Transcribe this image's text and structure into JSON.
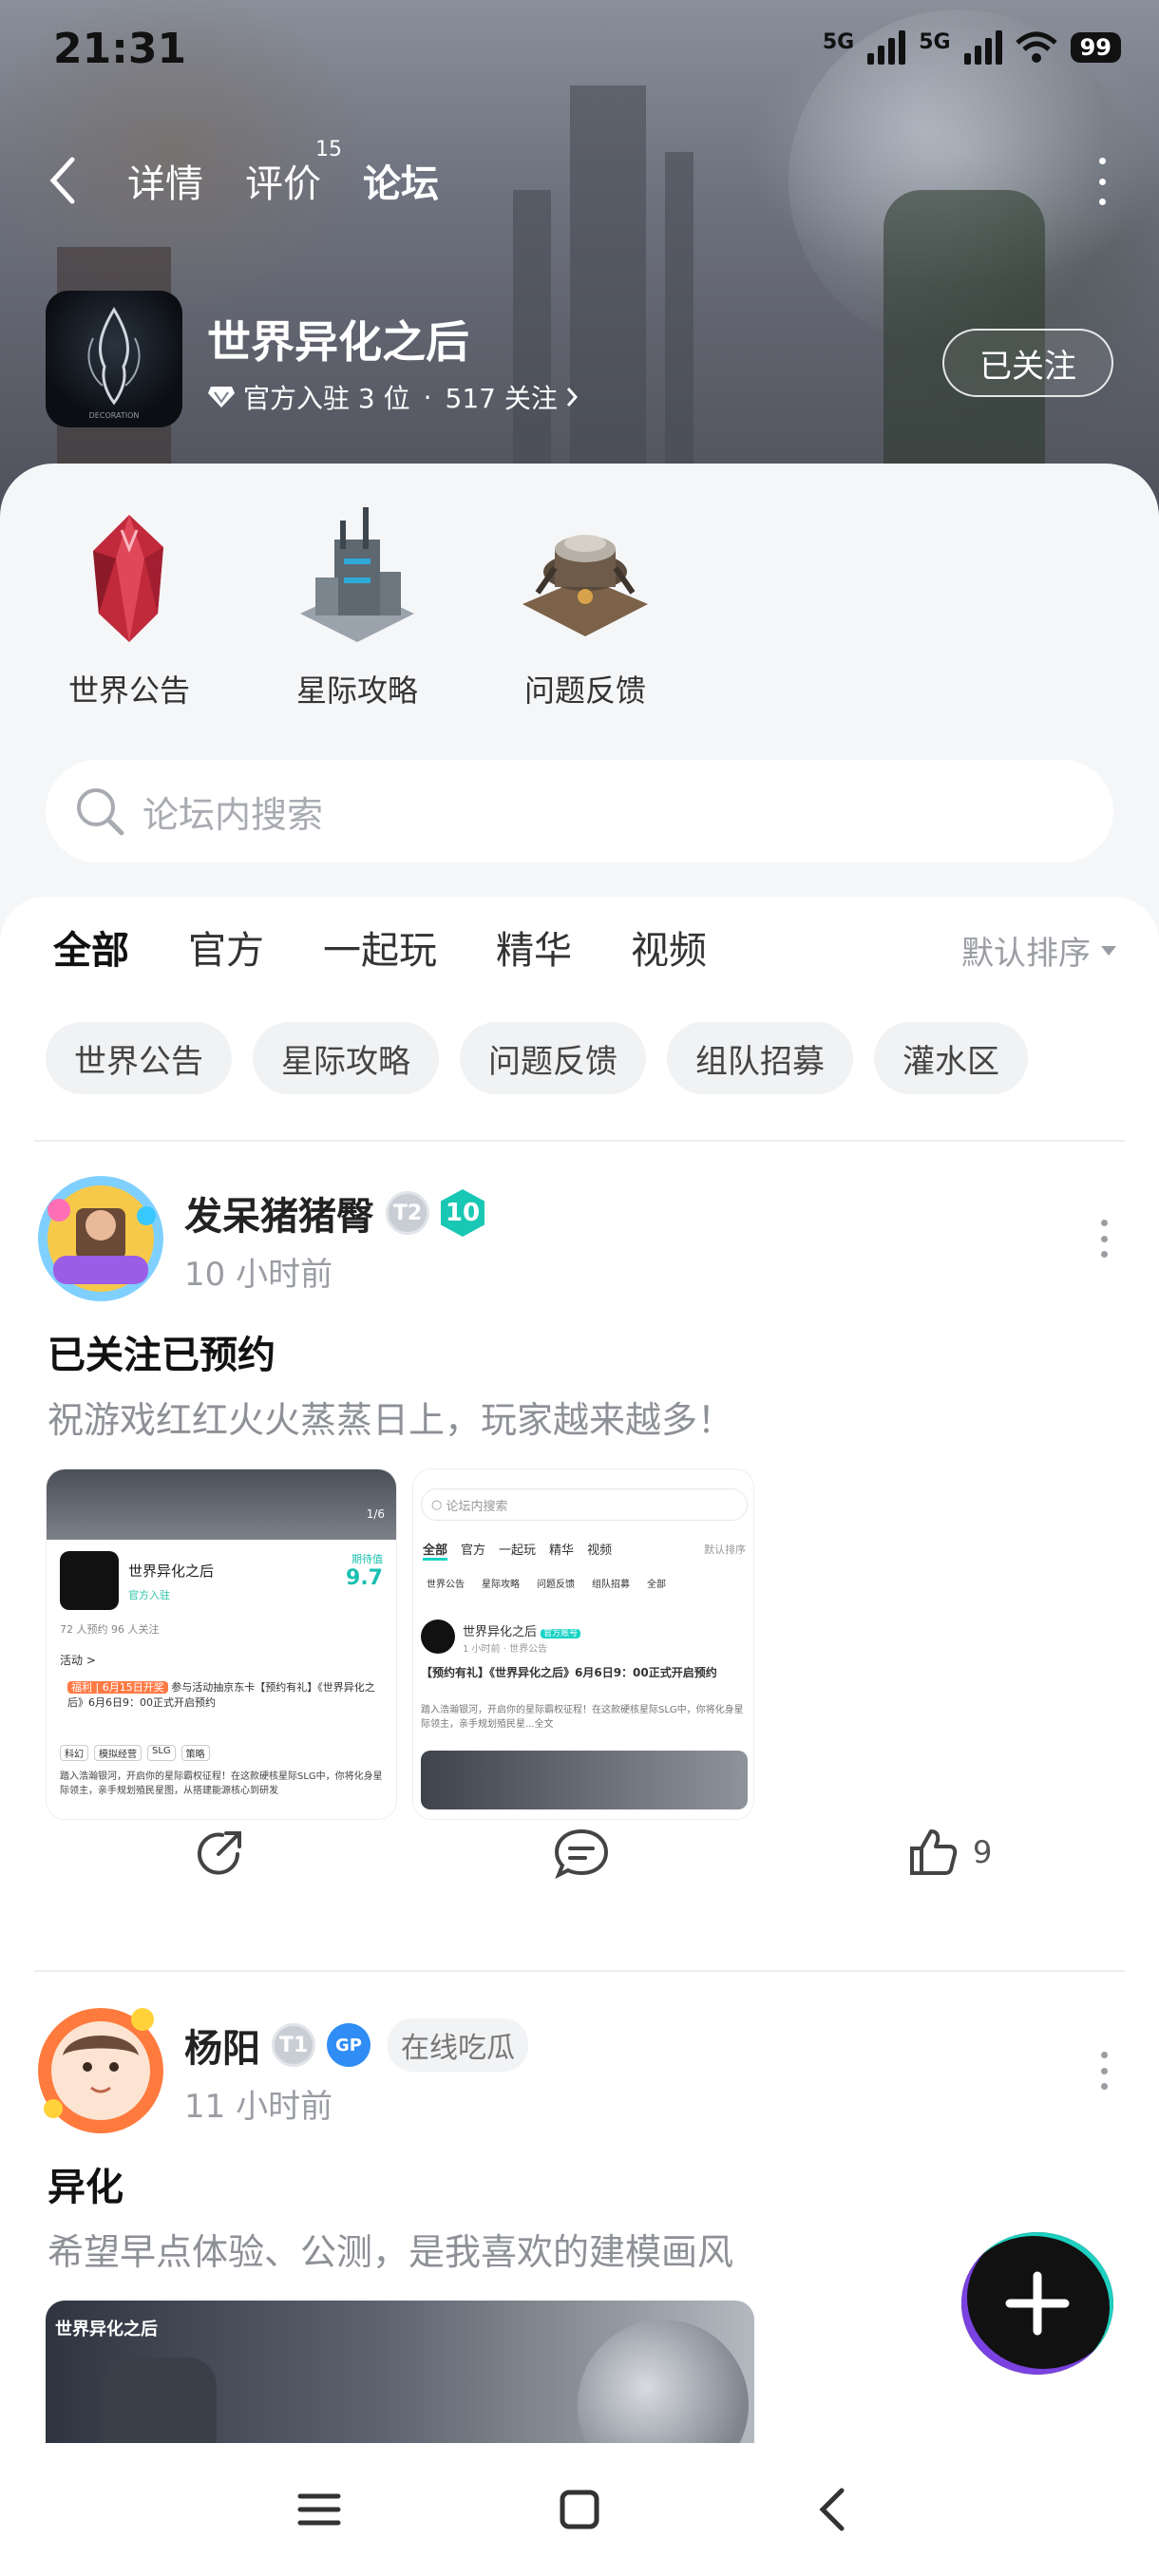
{
  "status_bar": {
    "time": "21:31",
    "net1": "5G",
    "net2": "5G",
    "battery": "99"
  },
  "top_nav": {
    "tabs": [
      {
        "label": "详情"
      },
      {
        "label": "评价",
        "count": "15"
      },
      {
        "label": "论坛"
      }
    ],
    "active_tab": "论坛"
  },
  "game": {
    "title": "世界异化之后",
    "icon_text": "DECORATION",
    "officials": "官方入驻 3 位",
    "separator": "·",
    "followers": "517 关注",
    "follow_button": "已关注"
  },
  "categories": [
    {
      "label": "世界公告"
    },
    {
      "label": "星际攻略"
    },
    {
      "label": "问题反馈"
    }
  ],
  "search": {
    "placeholder": "论坛内搜索"
  },
  "filter_tabs": [
    "全部",
    "官方",
    "一起玩",
    "精华",
    "视频"
  ],
  "sort_label": "默认排序",
  "chips": [
    "世界公告",
    "星际攻略",
    "问题反馈",
    "组队招募",
    "灌水区"
  ],
  "posts": [
    {
      "author": "发呆猪猪臀",
      "badge_t": "T2",
      "level": "10",
      "time": "10 小时前",
      "title": "已关注已预约",
      "body": "祝游戏红红火火蒸蒸日上，玩家越来越多！",
      "likes": "9",
      "thumb1": {
        "page": "1/6",
        "game": "世界异化之后",
        "score_label": "期待值",
        "score": "9.7",
        "tag": "官方入驻",
        "stats": "72 人预约    96 人关注",
        "activity": "活动 >",
        "promo_tag": "福利 | 6月15日开奖",
        "promo": "参与活动抽京东卡【预约有礼】《世界异化之后》6月6日9：00正式开启预约",
        "tags": [
          "科幻",
          "模拟经营",
          "SLG",
          "策略"
        ],
        "desc": "踏入浩瀚银河，开启你的星际霸权征程！在这款硬核星际SLG中，你将化身星际领主，亲手规划殖民星图，从搭建能源核心到研发"
      },
      "thumb2": {
        "search": "论坛内搜索",
        "tabs": [
          "全部",
          "官方",
          "一起玩",
          "精华",
          "视频"
        ],
        "sort": "默认排序",
        "chips": [
          "世界公告",
          "星际攻略",
          "问题反馈",
          "组队招募",
          "全部"
        ],
        "game": "世界异化之后",
        "official": "官方账号",
        "meta": "1 小时前 · 世界公告",
        "title": "【预约有礼】《世界异化之后》6月6日9：00正式开启预约",
        "desc": "踏入浩瀚银河，开启你的星际霸权征程！在这款硬核星际SLG中，你将化身星际领主，亲手规划殖民星...全文"
      }
    },
    {
      "author": "杨阳",
      "badge_t": "T1",
      "badge_gp": "GP",
      "tag": "在线吃瓜",
      "time": "11 小时前",
      "title": "异化",
      "body": "希望早点体验、公测，是我喜欢的建模画风",
      "image_caption": "世界异化之后"
    }
  ]
}
